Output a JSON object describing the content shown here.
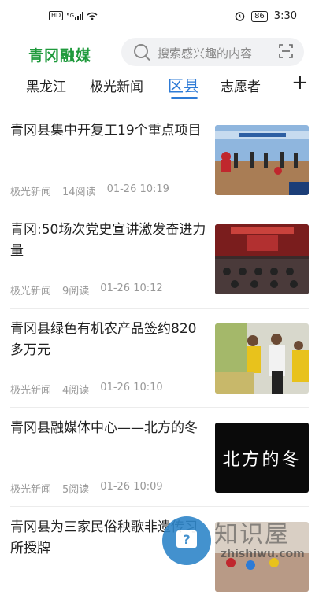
{
  "status_bar": {
    "network_left": "HD",
    "network_type": "5G",
    "battery": "86",
    "time": "3:30"
  },
  "header": {
    "app_name": "青冈融媒",
    "search_placeholder": "搜索感兴趣的内容"
  },
  "tabs": [
    {
      "label": "黑龙江"
    },
    {
      "label": "极光新闻"
    },
    {
      "label": "区县"
    },
    {
      "label": "志愿者"
    }
  ],
  "active_tab": "区县",
  "articles": [
    {
      "title": "青冈县集中开复工19个重点项目",
      "source": "极光新闻",
      "reads": "14阅读",
      "time": "01-26 10:19"
    },
    {
      "title": "青冈:50场次党史宣讲激发奋进力量",
      "source": "极光新闻",
      "reads": "9阅读",
      "time": "01-26 10:12"
    },
    {
      "title": "青冈县绿色有机农产品签约820多万元",
      "source": "极光新闻",
      "reads": "4阅读",
      "time": "01-26 10:10"
    },
    {
      "title": "青冈县融媒体中心——北方的冬",
      "source": "极光新闻",
      "reads": "5阅读",
      "time": "01-26 10:09",
      "thumb_text": "北方的冬"
    },
    {
      "title": "青冈县为三家民俗秧歌非遗传习所授牌",
      "source": "",
      "reads": "",
      "time": ""
    }
  ],
  "watermark": {
    "name": "知识屋",
    "url": "zhishiwu.com"
  },
  "colors": {
    "brand_green": "#1f9a3c",
    "accent_blue": "#2e7bd6"
  }
}
